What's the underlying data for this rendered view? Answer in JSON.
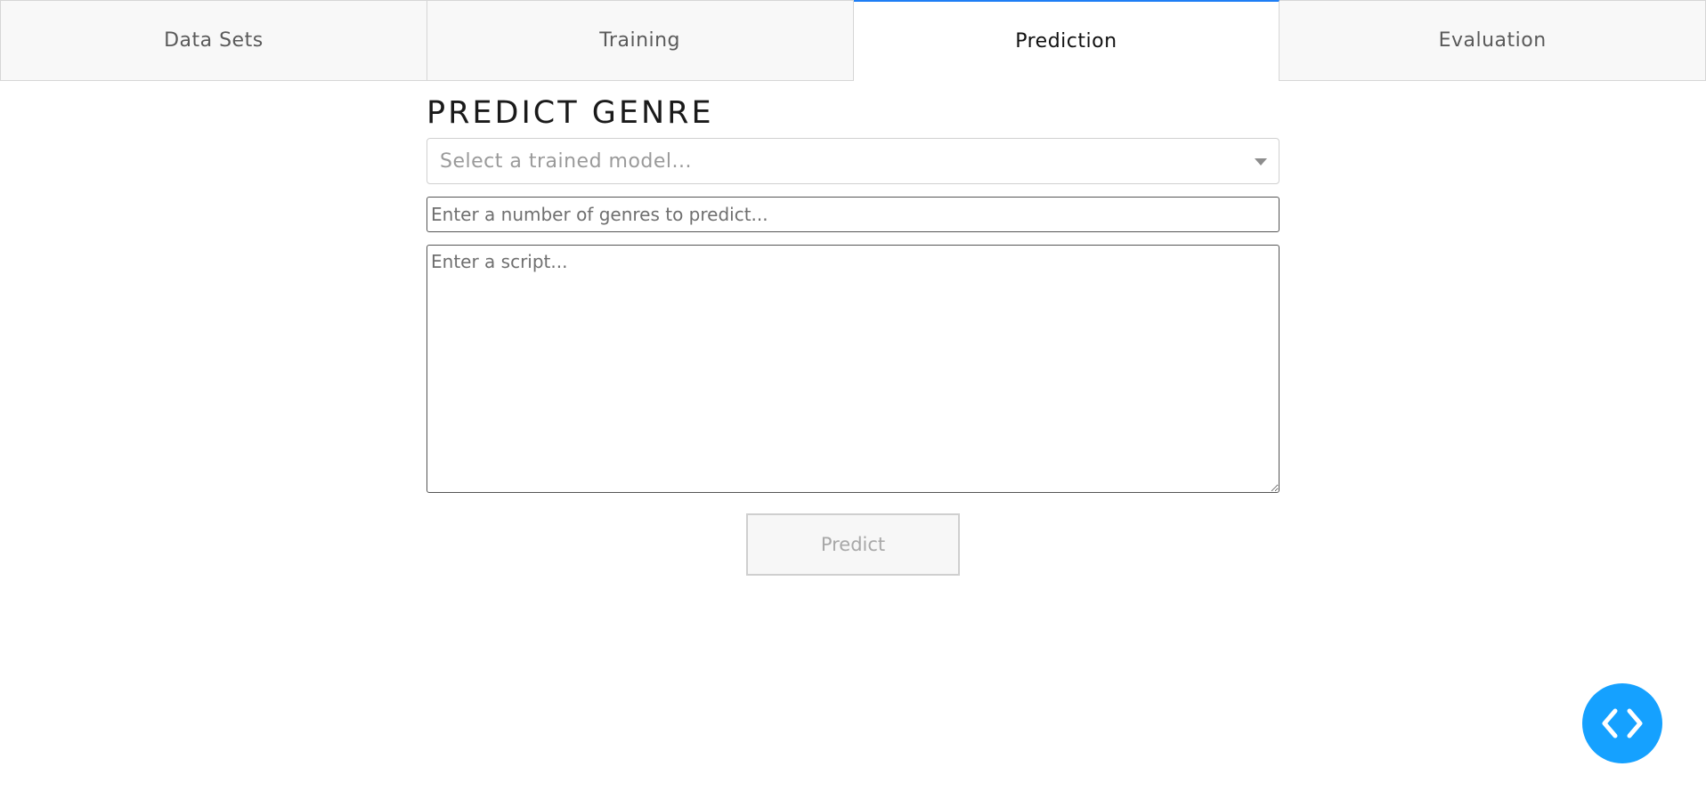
{
  "tabs": [
    {
      "label": "Data Sets",
      "active": false
    },
    {
      "label": "Training",
      "active": false
    },
    {
      "label": "Prediction",
      "active": true
    },
    {
      "label": "Evaluation",
      "active": false
    }
  ],
  "main": {
    "title": "PREDICT GENRE",
    "model_select": {
      "placeholder": "Select a trained model...",
      "value": ""
    },
    "genre_count_input": {
      "placeholder": "Enter a number of genres to predict...",
      "value": ""
    },
    "script_input": {
      "placeholder": "Enter a script...",
      "value": ""
    },
    "predict_label": "Predict"
  },
  "fab": {
    "icon": "code-brackets-icon",
    "color": "#15a1ff"
  },
  "colors": {
    "accent": "#1e7ef5",
    "fab": "#15a1ff"
  }
}
